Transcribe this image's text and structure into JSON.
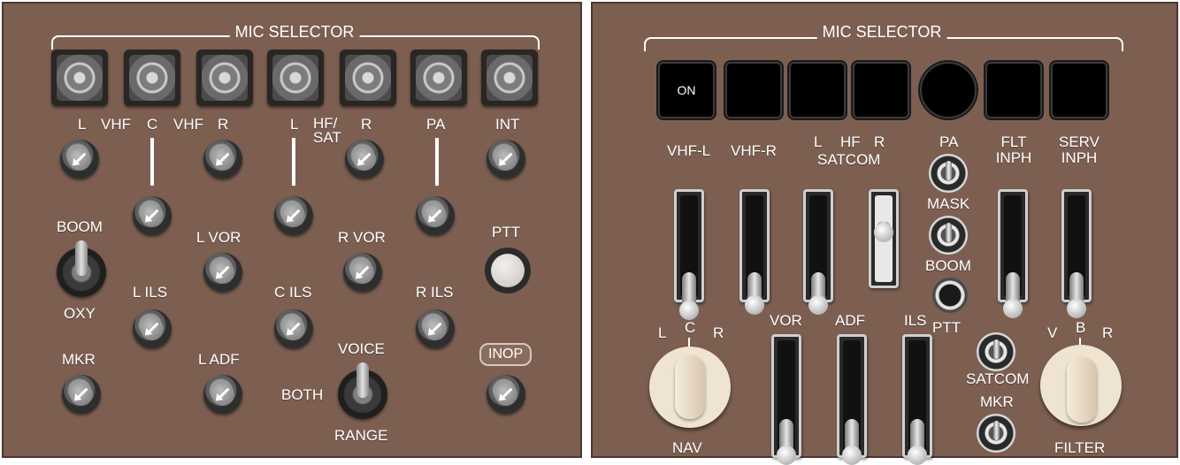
{
  "left_panel": {
    "title": "MIC SELECTOR",
    "labels": {
      "l": "L",
      "vhf1": "VHF",
      "c": "C",
      "vhf2": "VHF",
      "r": "R",
      "l2": "L",
      "hf_sat": "HF/\nSAT",
      "r2": "R",
      "pa": "PA",
      "int": "INT",
      "boom": "BOOM",
      "oxy": "OXY",
      "l_vor": "L VOR",
      "r_vor": "R VOR",
      "ptt": "PTT",
      "l_ils": "L ILS",
      "c_ils": "C ILS",
      "r_ils": "R ILS",
      "inop": "INOP",
      "mkr": "MKR",
      "l_adf": "L ADF",
      "voice": "VOICE",
      "both": "BOTH",
      "range": "RANGE"
    }
  },
  "right_panel": {
    "title": "MIC SELECTOR",
    "on_label": "ON",
    "labels": {
      "vhf_l": "VHF-L",
      "vhf_r": "VHF-R",
      "l": "L",
      "hf": "HF",
      "r": "R",
      "satcom": "SATCOM",
      "pa": "PA",
      "flt_inph": "FLT\nINPH",
      "serv_inph": "SERV\nINPH",
      "mask": "MASK",
      "boom": "BOOM",
      "ptt": "PTT",
      "nav_l": "L",
      "nav_c": "C",
      "nav_r": "R",
      "vor": "VOR",
      "adf": "ADF",
      "ils": "ILS",
      "hf2": "HF",
      "satcom2": "SATCOM",
      "mkr": "MKR",
      "filter_v": "V",
      "filter_b": "B",
      "filter_r": "R",
      "nav": "NAV",
      "filter": "FILTER"
    }
  },
  "colors": {
    "panel": "#7d5f52",
    "text": "#ffffff"
  },
  "icons": [
    "mic-select-button",
    "volume-knob",
    "toggle-switch",
    "ptt-button",
    "slider-lever",
    "rotary-selector"
  ]
}
